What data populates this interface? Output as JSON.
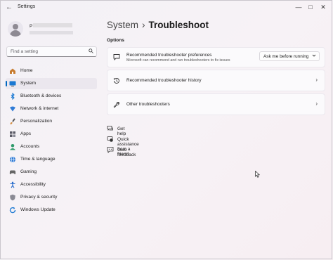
{
  "window": {
    "title": "Settings",
    "back_glyph": "←",
    "controls": {
      "minimize": "—",
      "maximize": "□",
      "close": "✕"
    }
  },
  "user": {
    "initial": "P"
  },
  "search": {
    "placeholder": "Find a setting",
    "icon": "search-icon"
  },
  "sidebar": {
    "items": [
      {
        "label": "Home",
        "icon": "home-icon",
        "color": "#b06a3b"
      },
      {
        "label": "System",
        "icon": "system-icon",
        "color": "#0067c0",
        "selected": true
      },
      {
        "label": "Bluetooth & devices",
        "icon": "bluetooth-icon",
        "color": "#0067c0"
      },
      {
        "label": "Network & internet",
        "icon": "network-icon",
        "color": "#2b6cb0"
      },
      {
        "label": "Personalization",
        "icon": "brush-icon",
        "color": "#c77b2e"
      },
      {
        "label": "Apps",
        "icon": "apps-icon",
        "color": "#4d4d55"
      },
      {
        "label": "Accounts",
        "icon": "accounts-icon",
        "color": "#2e8b57"
      },
      {
        "label": "Time & language",
        "icon": "globe-icon",
        "color": "#0067c0"
      },
      {
        "label": "Gaming",
        "icon": "gaming-icon",
        "color": "#555"
      },
      {
        "label": "Accessibility",
        "icon": "accessibility-icon",
        "color": "#1e66c9"
      },
      {
        "label": "Privacy & security",
        "icon": "shield-icon",
        "color": "#777"
      },
      {
        "label": "Windows Update",
        "icon": "update-icon",
        "color": "#0067c0"
      }
    ]
  },
  "breadcrumb": {
    "parent": "System",
    "separator": "›",
    "current": "Troubleshoot"
  },
  "main": {
    "section_title": "Options",
    "cards": [
      {
        "title": "Recommended troubleshooter preferences",
        "subtitle": "Microsoft can recommend and run troubleshooters to fix issues",
        "icon": "chat-icon",
        "dropdown_value": "Ask me before running"
      },
      {
        "title": "Recommended troubleshooter history",
        "icon": "history-icon",
        "chevron": "›"
      },
      {
        "title": "Other troubleshooters",
        "icon": "wrench-icon",
        "chevron": "›"
      }
    ],
    "links": [
      {
        "label": "Get help",
        "icon": "help-icon"
      },
      {
        "label": "Quick assistance from a friend",
        "icon": "quick-assist-icon"
      },
      {
        "label": "Give feedback",
        "icon": "feedback-icon"
      }
    ]
  }
}
